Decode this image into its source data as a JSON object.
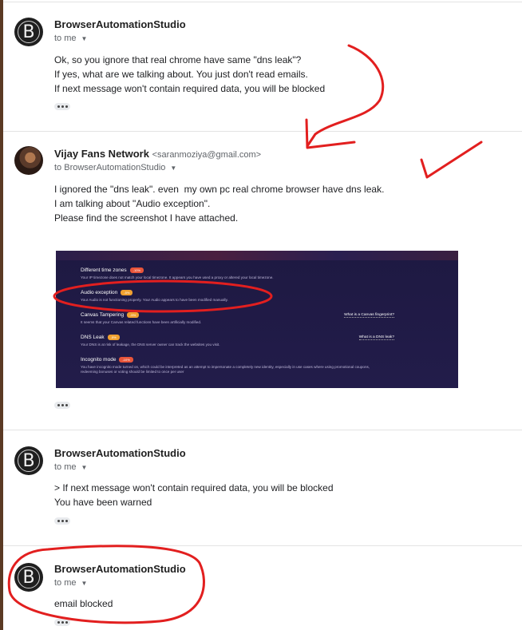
{
  "messages": [
    {
      "sender": "BrowserAutomationStudio",
      "recipient": "to me",
      "avatar_letter": "B",
      "body": "Ok, so you ignore that real chrome have same \"dns leak\"?\nIf yes, what are we talking about. You just don't read emails.\nIf next message won't contain required data, you will be blocked"
    },
    {
      "sender": "Vijay Fans Network",
      "email": "<saranmoziya@gmail.com>",
      "recipient": "to BrowserAutomationStudio",
      "body": "I ignored the \"dns leak\". even  my own pc real chrome browser have dns leak.\nI am talking about \"Audio exception\".\nPlease find the screenshot I have attached.",
      "attachment": {
        "rows": [
          {
            "title": "Different time zones",
            "badge": "-10%",
            "badge_color": "#e8553a",
            "desc": "Your IP timezone does not match your local timezone. It appears you have used a proxy or altered your local timezone.",
            "link": ""
          },
          {
            "title": "Audio exception",
            "badge": "-5%",
            "badge_color": "#f0a030",
            "desc": "Your Audio is not functioning properly. Your Audio appears to have been modified manually.",
            "link": ""
          },
          {
            "title": "Canvas Tampering",
            "badge": "-5%",
            "badge_color": "#f0a030",
            "desc": "It seems that your Canvas related functions have been artificially modified.",
            "link": "What is a Canvas fingerprint?"
          },
          {
            "title": "DNS Leak",
            "badge": "-5%",
            "badge_color": "#f0a030",
            "desc": "Your DNS is at risk of leakage, the DNS server owner can track the websites you visit.",
            "link": "What is a DNS leak?"
          },
          {
            "title": "Incognito mode",
            "badge": "-10%",
            "badge_color": "#e8553a",
            "desc": "You have incognito mode turned on, which could be interpreted as an attempt to impersonate a completely new identity, especially in use cases where using promotional coupons,\nredeeming bonuses or voting should be limited to once per user",
            "link": ""
          }
        ]
      }
    },
    {
      "sender": "BrowserAutomationStudio",
      "recipient": "to me",
      "avatar_letter": "B",
      "body": "> If next message won't contain required data, you will be blocked\nYou have been warned"
    },
    {
      "sender": "BrowserAutomationStudio",
      "recipient": "to me",
      "avatar_letter": "B",
      "body": "email blocked"
    }
  ],
  "colors": {
    "annotation_red": "#e21f1f",
    "attachment_bg": "#1e1942"
  }
}
